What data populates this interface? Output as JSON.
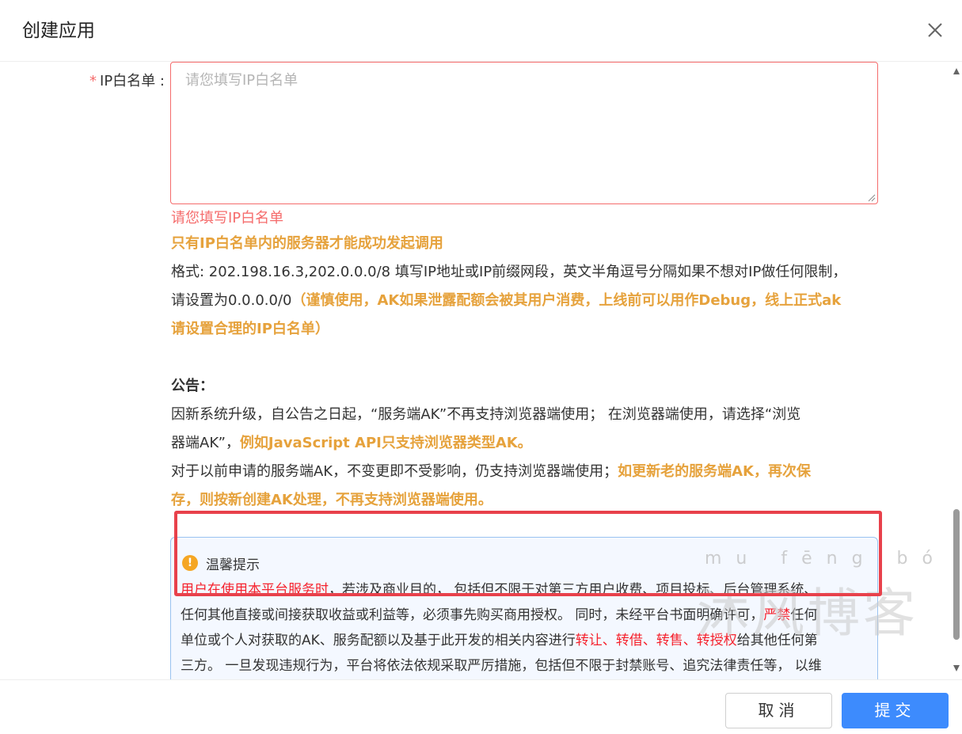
{
  "dialog": {
    "title": "创建应用",
    "close_icon": "close-icon"
  },
  "form": {
    "ip_whitelist": {
      "required_mark": "*",
      "label": "IP白名单 :",
      "value": "",
      "placeholder": "请您填写IP白名单",
      "error": "请您填写IP白名单",
      "hint": "只有IP白名单内的服务器才能成功发起调用",
      "format_line1": "格式: 202.198.16.3,202.0.0.0/8 填写IP地址或IP前缀网段，英文半角逗号分隔如果不想对IP做任何限制，",
      "format_line2_prefix": "请设置为0.0.0.0/0",
      "format_line2_warn": "（谨慎使用，AK如果泄露配额会被其用户消费，上线前可以用作Debug，线上正式ak",
      "format_line3_warn": "请设置合理的IP白名单）"
    }
  },
  "notice": {
    "title": "公告：",
    "p1_line1": "因新系统升级，自公告之日起，“服务端AK”不再支持浏览器端使用； 在浏览器端使用，请选择“浏览",
    "p1_line2_prefix": "器端AK”，",
    "p1_line2_warn": "例如JavaScript API只支持浏览器类型AK。",
    "p2_line1_prefix": "对于以前申请的服务端AK，不变更即不受影响，仍支持浏览器端使用；",
    "p2_line1_warn": "如更新老的服务端AK，再次保",
    "p2_line2_warn": "存，则按新创建AK处理，不再支持浏览器端使用。"
  },
  "tip": {
    "icon": "warning-icon",
    "title": "温馨提示",
    "l1_red": "用户在使用本平台服务时",
    "l1_rest": "，若涉及商业目的， 包括但不限于对第三方用户收费、项目投标、后台管理系统、",
    "l2": "任何其他直接或间接获取收益或利益等，必须事先购买商用授权。 同时，未经平台书面明确许可，",
    "l2_red": "严禁",
    "l2_end": "任何",
    "l3_prefix": "单位或个人对获取的AK、服务配额以及基于此开发的相关内容进行",
    "l3_red": "转让、转借、转售、转授权",
    "l3_end": "给其他任何第",
    "l4": "三方。 一旦发现违规行为，平台将依法依规采取严厉措施，包括但不限于封禁账号、追究法律责任等， 以维"
  },
  "watermark": {
    "pinyin": "mu  fēng  bó  kè",
    "chars": "沐风博客"
  },
  "footer": {
    "cancel_label": "取消",
    "submit_label": "提交"
  },
  "colors": {
    "error": "#f56c6c",
    "warning": "#e6a23c",
    "primary": "#3d8bfd",
    "danger": "#f5222d",
    "highlight_border": "#e8414b"
  },
  "scrollbar": {
    "position_fraction": 0.78
  }
}
